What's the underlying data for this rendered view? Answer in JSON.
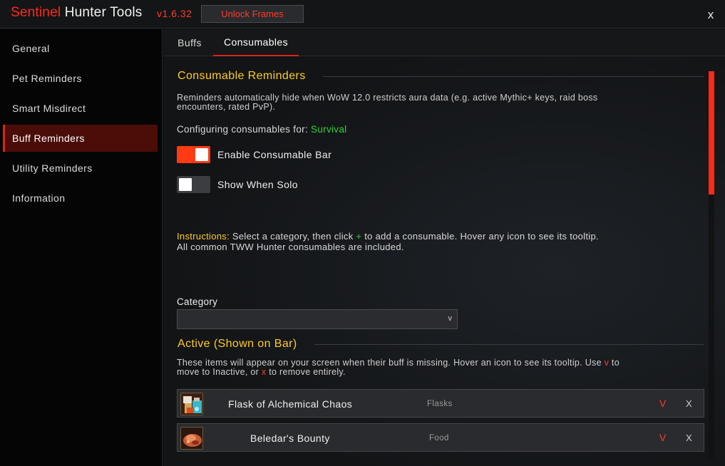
{
  "window": {
    "title_part1": "Sentinel",
    "title_part2": " Hunter Tools",
    "version": "v1.6.32",
    "unlock_label": "Unlock Frames",
    "close_label": "x"
  },
  "sidebar": {
    "items": [
      {
        "label": "General"
      },
      {
        "label": "Pet Reminders"
      },
      {
        "label": "Smart Misdirect"
      },
      {
        "label": "Buff Reminders",
        "active": true
      },
      {
        "label": "Utility Reminders"
      },
      {
        "label": "Information"
      }
    ]
  },
  "tabs": [
    {
      "label": "Buffs"
    },
    {
      "label": "Consumables",
      "active": true
    }
  ],
  "consumable_section": {
    "title": "Consumable Reminders",
    "description_line1": "Reminders automatically hide when WoW 12.0 restricts aura data (e.g. active Mythic+ keys, raid boss",
    "description_line2": "encounters, rated PvP).",
    "configuring_prefix": "Configuring consumables for: ",
    "spec": "Survival",
    "toggles": [
      {
        "label": "Enable Consumable Bar",
        "on": true
      },
      {
        "label": "Show When Solo",
        "on": false
      }
    ],
    "instructions_label": "Instructions:",
    "instructions_part1": " Select a category, then click ",
    "instructions_plus": "+",
    "instructions_part2": " to add a consumable. Hover any icon to see its tooltip.",
    "instructions_line2": "All common TWW Hunter consumables are included.",
    "category_label": "Category",
    "category_value": "",
    "category_arrow": "v"
  },
  "active_section": {
    "title": "Active (Shown on Bar)",
    "desc_part1": "These items will appear on your screen when their buff is missing. Hover an icon to see its tooltip. Use ",
    "desc_v": "v",
    "desc_part2": " to",
    "desc_line2_part1": "move to Inactive, or ",
    "desc_x": "x",
    "desc_line2_part2": " to remove entirely.",
    "items": [
      {
        "name": "Flask of Alchemical Chaos",
        "category": "Flasks",
        "move": "V",
        "remove": "X"
      },
      {
        "name": "Beledar's Bounty",
        "category": "Food",
        "move": "V",
        "remove": "X"
      }
    ]
  },
  "colors": {
    "accent": "#ff3b14",
    "section_title": "#ffcc22",
    "spec": "#2fd23a"
  }
}
